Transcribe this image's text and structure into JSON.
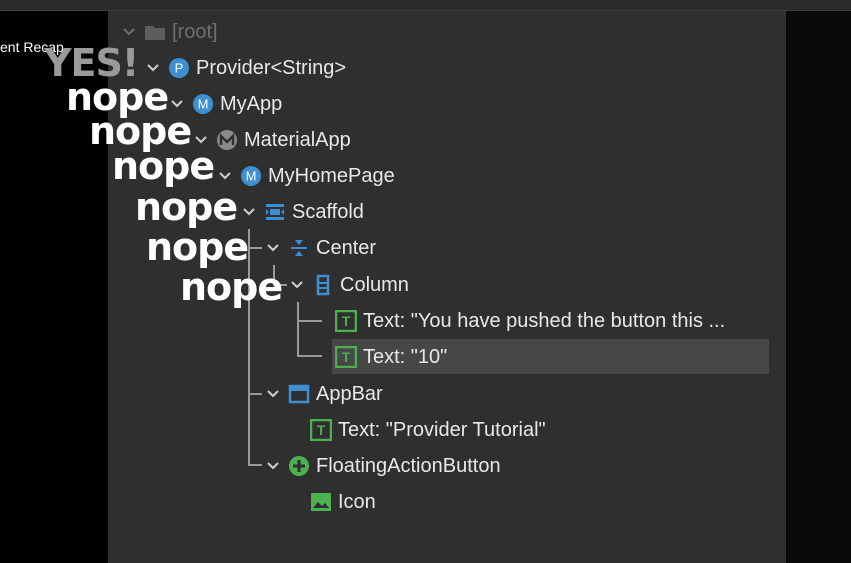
{
  "recap_text": "ent Recap",
  "overlays": [
    "YES!",
    "nope",
    "nope",
    "nope",
    "nope",
    "nope",
    "nope"
  ],
  "tree": {
    "root": "[root]",
    "provider": "Provider<String>",
    "myapp": "MyApp",
    "materialapp": "MaterialApp",
    "myhomepage": "MyHomePage",
    "scaffold": "Scaffold",
    "center": "Center",
    "column": "Column",
    "text1": "Text: \"You have pushed the button this ...",
    "text2": "Text: \"10\"",
    "appbar": "AppBar",
    "text3": "Text: \"Provider Tutorial\"",
    "fab": "FloatingActionButton",
    "icon": "Icon"
  },
  "icon_letters": {
    "provider": "P",
    "myapp": "M",
    "myhomepage": "M",
    "text": "T"
  },
  "colors": {
    "blue": "#3d8fd1",
    "green": "#4caf50",
    "gray": "#8a8a8a",
    "folder": "#5d5d5d"
  }
}
